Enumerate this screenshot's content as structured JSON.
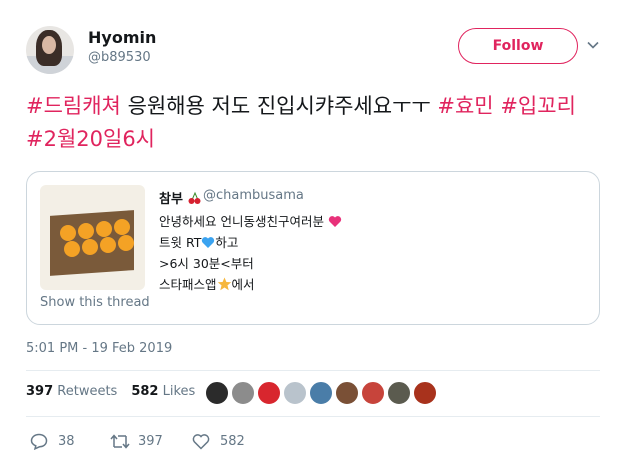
{
  "author": {
    "name": "Hyomin",
    "handle": "@b89530",
    "follow_label": "Follow"
  },
  "tweet": {
    "segments": [
      {
        "text": "#드림캐쳐",
        "type": "hashtag"
      },
      {
        "text": " 응원해용 저도 진입시캬주세요ㅜㅜ ",
        "type": "text"
      },
      {
        "text": "#효민",
        "type": "hashtag"
      },
      {
        "text": " ",
        "type": "text"
      },
      {
        "text": "#입꼬리",
        "type": "hashtag"
      },
      {
        "text": " ",
        "type": "text"
      },
      {
        "text": "#2월20일6시",
        "type": "hashtag"
      }
    ]
  },
  "quote": {
    "name": "참부",
    "handle": "@chambusama",
    "lines": [
      "안녕하세요 언니동생친구여러분",
      "트윗 RT",
      "하고",
      ">6시 30분<부터",
      "스타패스앱",
      "에서"
    ],
    "show_thread": "Show this thread"
  },
  "timestamp": "5:01 PM - 19 Feb 2019",
  "stats": {
    "retweets_count": "397",
    "retweets_label": "Retweets",
    "likes_count": "582",
    "likes_label": "Likes"
  },
  "liker_avatar_colors": [
    "#2b2b2b",
    "#8c8c8c",
    "#d8262e",
    "#b9c3cc",
    "#4a7da8",
    "#7a5036",
    "#c7443b",
    "#5b5b4f",
    "#a8321c"
  ],
  "actions": {
    "reply_count": "38",
    "retweet_count": "397",
    "like_count": "582"
  },
  "colors": {
    "accent": "#e0245e",
    "muted": "#657786",
    "text": "#14171a"
  }
}
